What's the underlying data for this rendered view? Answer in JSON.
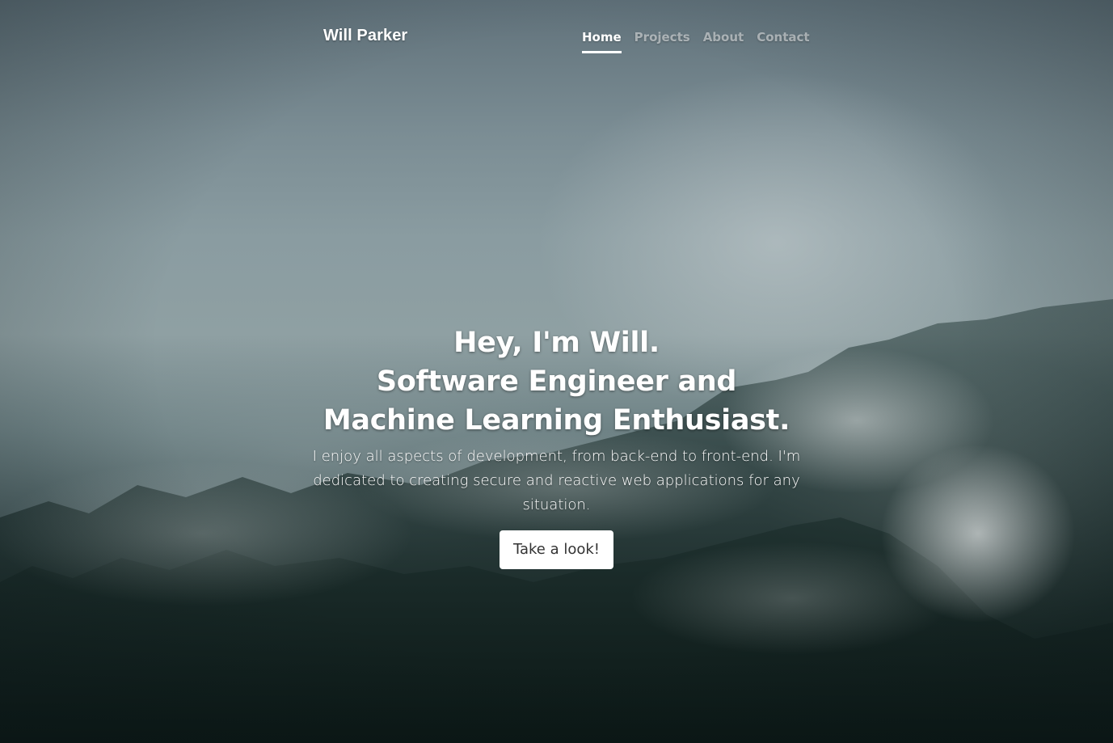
{
  "header": {
    "brand": "Will Parker",
    "nav": [
      {
        "label": "Home",
        "active": true
      },
      {
        "label": "Projects",
        "active": false
      },
      {
        "label": "About",
        "active": false
      },
      {
        "label": "Contact",
        "active": false
      }
    ]
  },
  "hero": {
    "heading_lines": [
      "Hey, I'm Will.",
      "Software Engineer and",
      "Machine Learning Enthusiast."
    ],
    "lead": "I enjoy all aspects of development, from back-end to front-end. I'm dedicated to creating secure and reactive web applications for any situation.",
    "button_label": "Take a look!"
  },
  "colors": {
    "text": "#ffffff",
    "nav_inactive": "rgba(255,255,255,0.5)",
    "button_bg": "#ffffff",
    "button_text": "#333333"
  }
}
